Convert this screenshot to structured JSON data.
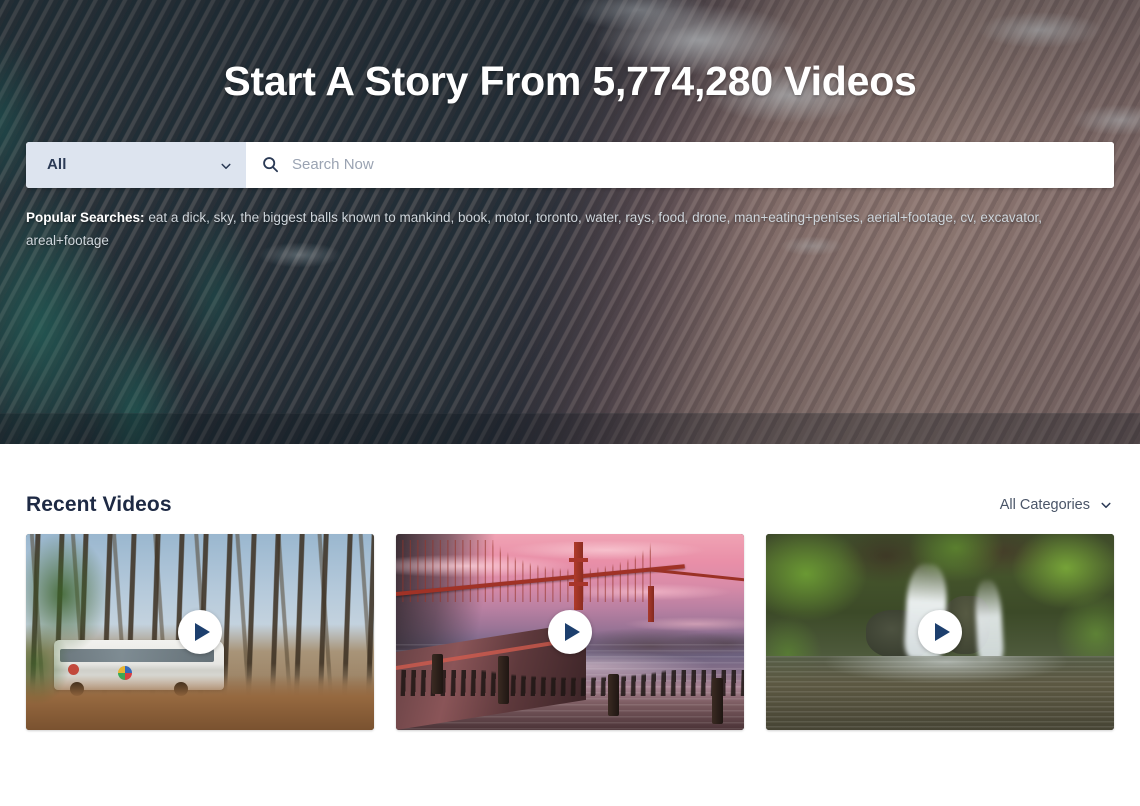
{
  "hero": {
    "title": "Start A Story From 5,774,280 Videos",
    "search": {
      "category_selected": "All",
      "category_chevron_icon": "chevron-down-icon",
      "search_icon": "search-icon",
      "input_value": "",
      "placeholder": "Search Now"
    },
    "popular": {
      "label": "Popular Searches:",
      "terms": "eat a dick, sky, the biggest balls known to mankind, book, motor, toronto, water, rays, food, drone, man+eating+penises, aerial+footage, cv, excavator, areal+footage"
    },
    "background_image": "aerial-coastline-ocean-rocks"
  },
  "main": {
    "section_title": "Recent Videos",
    "category_filter": {
      "label": "All Categories",
      "chevron_icon": "chevron-down-icon"
    },
    "videos": [
      {
        "thumbnail": "forest-road-white-bus",
        "play_icon": "play-icon"
      },
      {
        "thumbnail": "golden-gate-bridge-sunset",
        "play_icon": "play-icon"
      },
      {
        "thumbnail": "forest-waterfall-stream",
        "play_icon": "play-icon"
      }
    ]
  },
  "colors": {
    "heading": "#1e2a44",
    "select_bg": "#dde4ef",
    "select_text": "#2b3a55",
    "placeholder": "#9aa3b2",
    "play_triangle": "#1d3f6e",
    "page_bg": "#ffffff"
  }
}
